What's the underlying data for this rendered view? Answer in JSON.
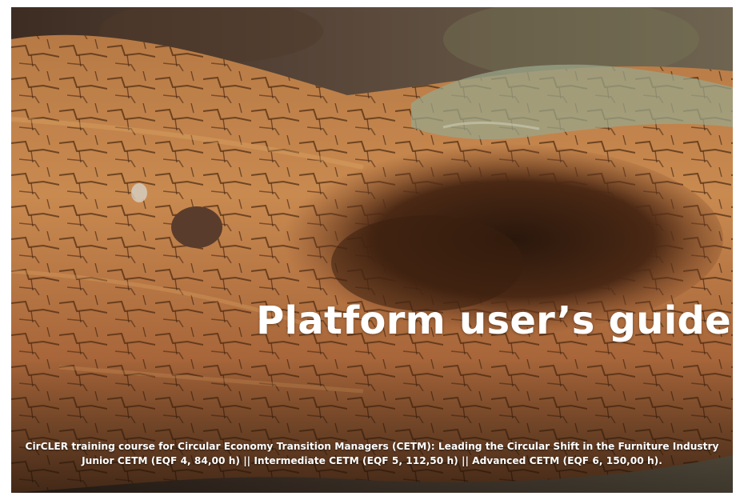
{
  "cover": {
    "image": "weathered-wood-log-with-lichen",
    "title": "Platform user’s guide",
    "subtitle_line1": "CirCLER training course for Circular Economy Transition Managers (CETM): Leading the Circular Shift in the Furniture Industry",
    "subtitle_line2": "Junior CETM (EQF 4, 84,00 h) || Intermediate CETM (EQF 5, 112,50 h) || Advanced CETM (EQF 6, 150,00 h)."
  },
  "colors": {
    "wood_light": "#c8854a",
    "wood_dark": "#4a2a14",
    "lichen": "#9aa58a",
    "text": "#ffffff"
  }
}
